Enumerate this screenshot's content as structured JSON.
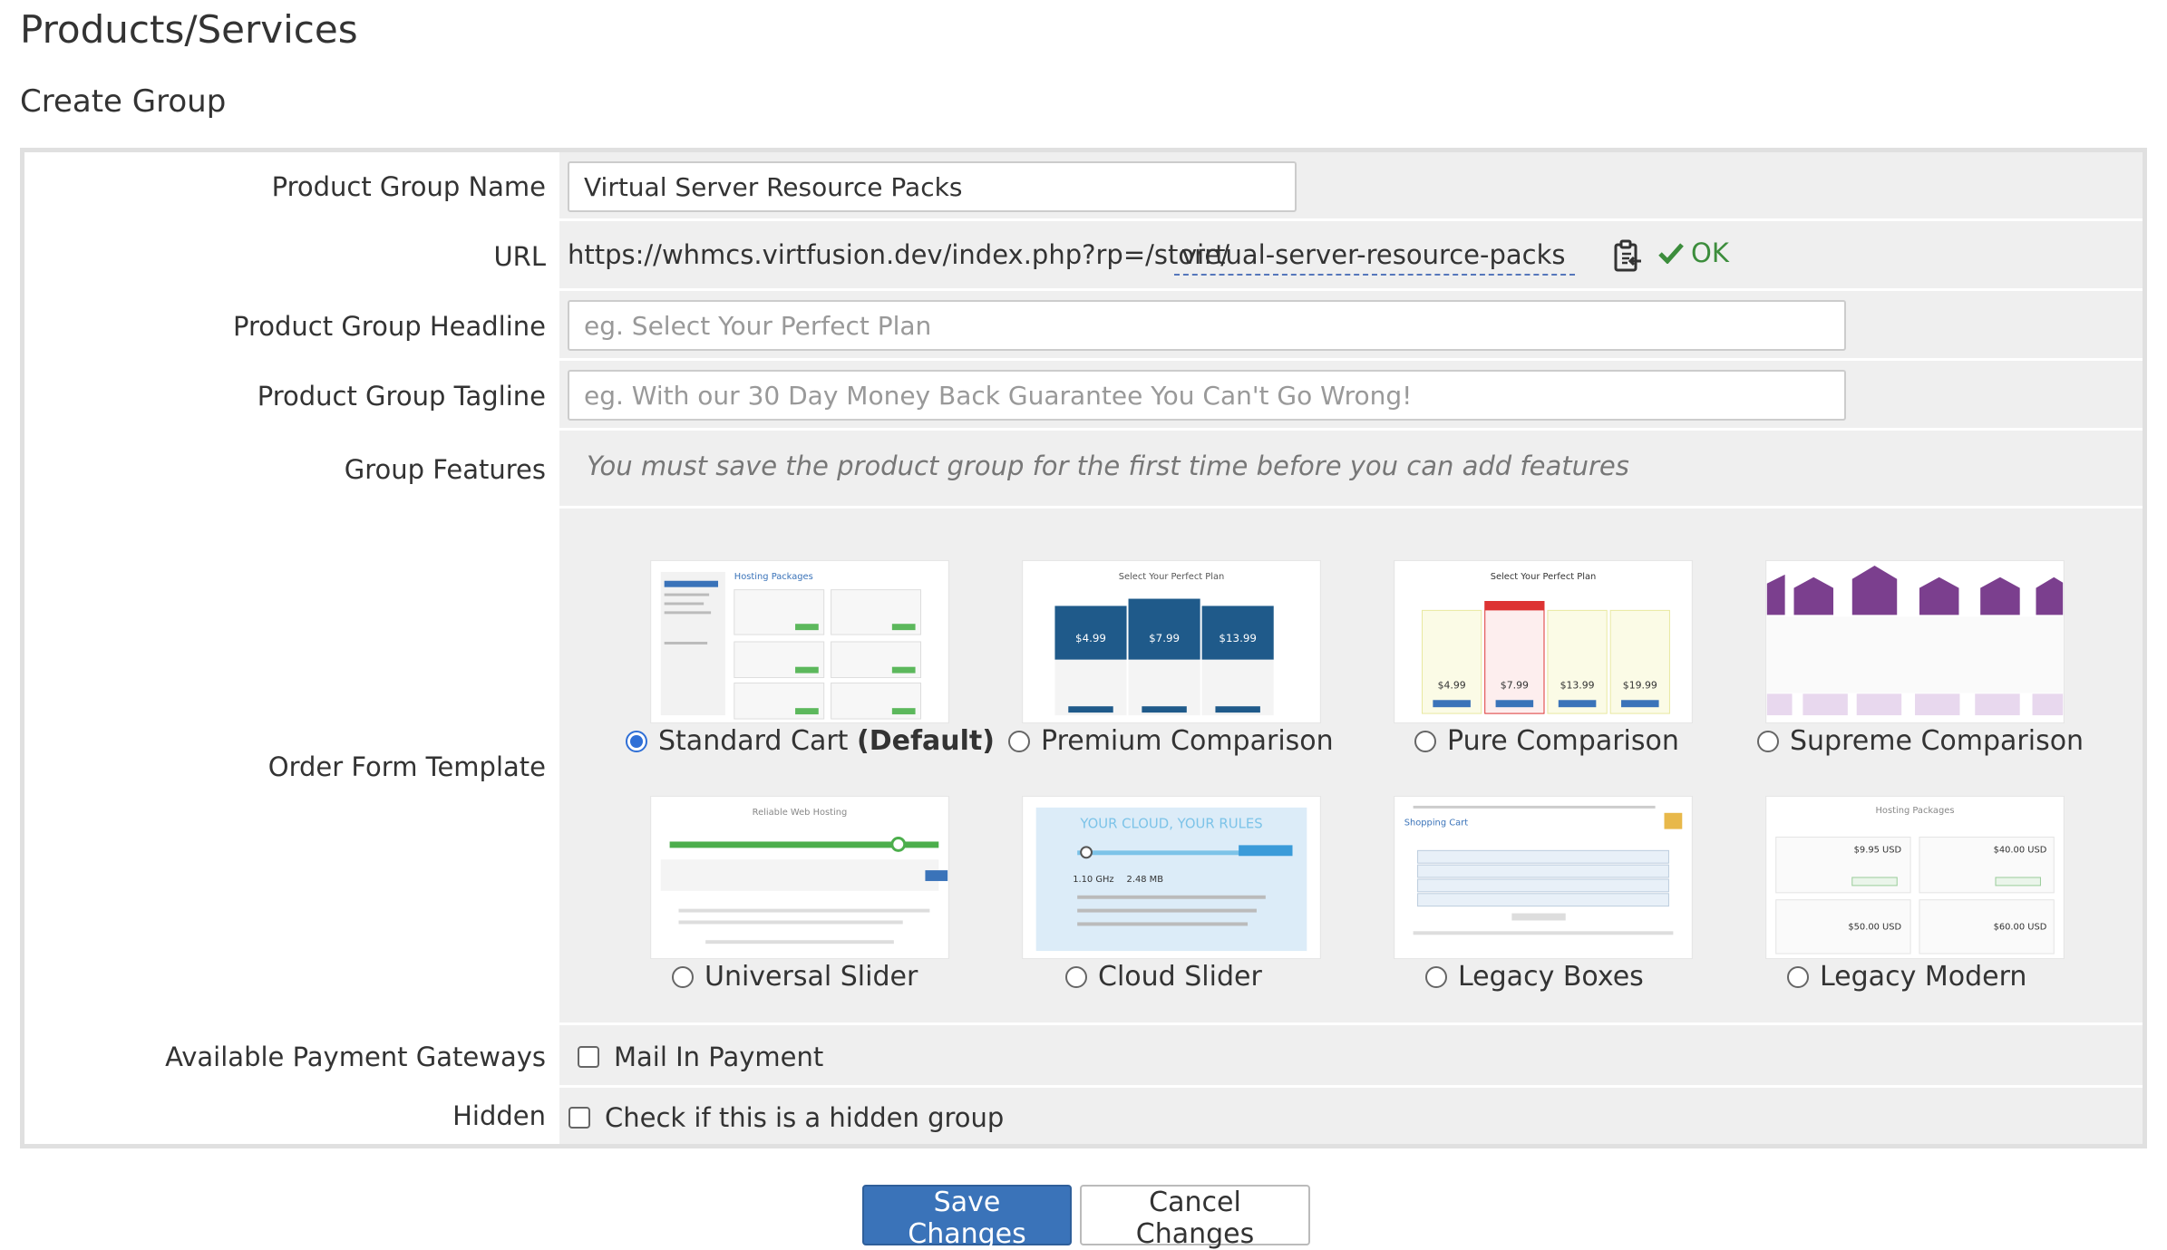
{
  "header": {
    "title": "Products/Services",
    "subtitle": "Create Group"
  },
  "form": {
    "group_name": {
      "label": "Product Group Name",
      "value": "Virtual Server Resource Packs"
    },
    "url": {
      "label": "URL",
      "prefix": "https://whmcs.virtfusion.dev/index.php?rp=/store/",
      "slug": "virtual-server-resource-packs",
      "copy_icon": "clipboard-icon",
      "status_icon": "check-icon",
      "status": "OK",
      "status_color": "#3c8d3c"
    },
    "headline": {
      "label": "Product Group Headline",
      "value": "",
      "placeholder": "eg. Select Your Perfect Plan"
    },
    "tagline": {
      "label": "Product Group Tagline",
      "value": "",
      "placeholder": "eg. With our 30 Day Money Back Guarantee You Can't Go Wrong!"
    },
    "features": {
      "label": "Group Features",
      "note": "You must save the product group for the first time before you can add features"
    },
    "order_form": {
      "label": "Order Form Template",
      "selected": "Standard Cart",
      "templates": [
        {
          "name": "Standard Cart",
          "suffix": "(Default)",
          "checked": true
        },
        {
          "name": "Premium Comparison",
          "checked": false
        },
        {
          "name": "Pure Comparison",
          "checked": false
        },
        {
          "name": "Supreme Comparison",
          "checked": false
        },
        {
          "name": "Universal Slider",
          "checked": false
        },
        {
          "name": "Cloud Slider",
          "checked": false
        },
        {
          "name": "Legacy Boxes",
          "checked": false
        },
        {
          "name": "Legacy Modern",
          "checked": false
        }
      ]
    },
    "gateways": {
      "label": "Available Payment Gateways",
      "options": [
        {
          "name": "Mail In Payment",
          "checked": false
        }
      ]
    },
    "hidden": {
      "label": "Hidden",
      "checkbox_label": "Check if this is a hidden group",
      "checked": false
    }
  },
  "actions": {
    "save": "Save Changes",
    "cancel": "Cancel Changes",
    "primary_color": "#3a73b9"
  }
}
